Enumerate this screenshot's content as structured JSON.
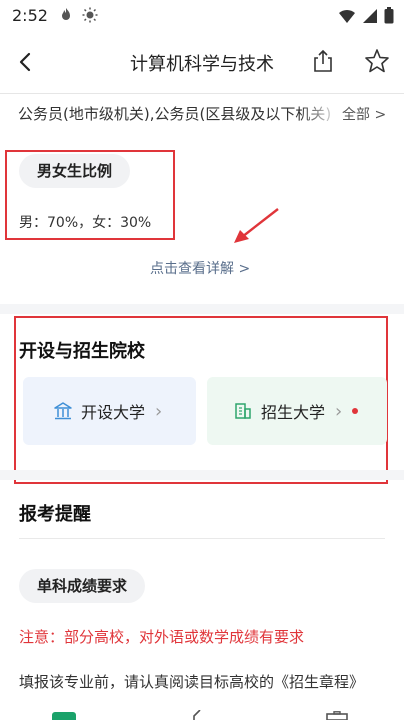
{
  "status_bar": {
    "time": "2:52"
  },
  "header": {
    "title": "计算机科学与技术"
  },
  "career": {
    "text": "公务员(地市级机关),公务员(区县级及以下机关)",
    "all_label": "全部 >"
  },
  "gender": {
    "pill": "男女生比例",
    "ratio": "男：70%，女：30%",
    "detail_link": "点击查看详解 >"
  },
  "schools": {
    "title": "开设与招生院校",
    "open_label": "开设大学",
    "enroll_label": "招生大学",
    "open_icon": "institution-icon",
    "enroll_icon": "building-icon"
  },
  "reminder": {
    "title": "报考提醒",
    "pill": "单科成绩要求",
    "notice": "注意：部分高校，对外语或数学成绩有要求",
    "fill_text": "填报该专业前，请认真阅读目标高校的《招生章程》"
  },
  "colors": {
    "accent_red": "#e0353a",
    "link": "#5a6f8c",
    "brand_green": "#1aa26a"
  }
}
